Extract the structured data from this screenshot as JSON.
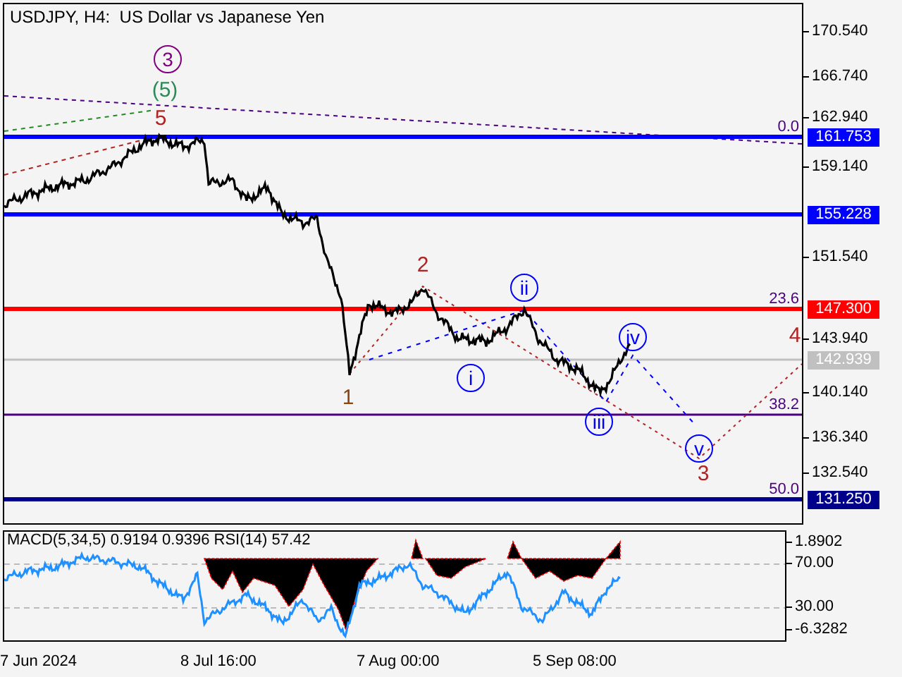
{
  "chart": {
    "title": "USDJPY, H4:  US Dollar vs Japanese Yen",
    "price_axis": [
      "170.540",
      "166.740",
      "162.940",
      "159.140",
      "151.540",
      "143.940",
      "140.140",
      "136.340",
      "132.540"
    ],
    "levels": [
      {
        "price_label": "161.753",
        "fib_label": "0.0",
        "color": "#0000ff"
      },
      {
        "price_label": "155.228",
        "color": "#0000ff"
      },
      {
        "price_label": "147.300",
        "fib_label": "23.6",
        "color": "#ff0000"
      },
      {
        "price_label": "142.939",
        "color": "#c0c0c0"
      },
      {
        "fib_label": "38.2",
        "color": "#4b0082"
      },
      {
        "price_label": "131.250",
        "fib_label": "50.0",
        "color": "#00008b"
      }
    ],
    "wave_labels": [
      {
        "text": "3",
        "kind": "circled",
        "color": "#800080"
      },
      {
        "text": "(5)",
        "kind": "plain",
        "color": "#2e8b57"
      },
      {
        "text": "5",
        "kind": "plain",
        "color": "#b22222"
      },
      {
        "text": "1",
        "kind": "plain",
        "color": "#8b4513"
      },
      {
        "text": "2",
        "kind": "plain",
        "color": "#b22222"
      },
      {
        "text": "i",
        "kind": "circled",
        "color": "#0000ff"
      },
      {
        "text": "ii",
        "kind": "circled",
        "color": "#0000ff"
      },
      {
        "text": "iii",
        "kind": "circled",
        "color": "#0000ff"
      },
      {
        "text": "iv",
        "kind": "circled",
        "color": "#0000ff"
      },
      {
        "text": "v",
        "kind": "circled",
        "color": "#0000ff"
      },
      {
        "text": "3",
        "kind": "plain",
        "color": "#b22222"
      },
      {
        "text": "4",
        "kind": "plain",
        "color": "#b22222"
      }
    ]
  },
  "indicator": {
    "legend": "MACD(5,34,5) 0.9194 0.9396 RSI(14) 57.42",
    "axis": [
      "1.8902",
      "70.00",
      "30.00",
      "-6.3282"
    ]
  },
  "time_axis": [
    "7 Jun 2024",
    "8 Jul 16:00",
    "7 Aug 00:00",
    "5 Sep 08:00"
  ]
}
